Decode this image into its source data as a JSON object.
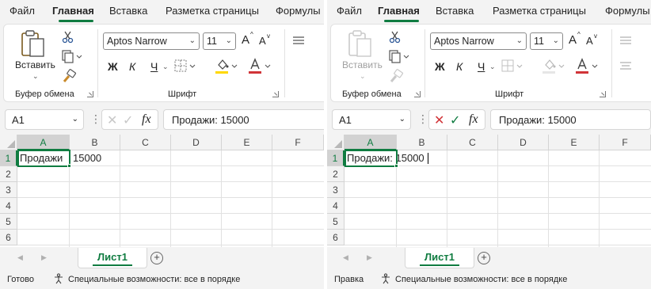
{
  "tabs": [
    "Файл",
    "Главная",
    "Вставка",
    "Разметка страницы",
    "Формулы"
  ],
  "ribbon": {
    "paste_label": "Вставить",
    "clipboard_group": "Буфер обмена",
    "font_group": "Шрифт",
    "font_name": "Aptos Narrow",
    "font_size": "11",
    "bold": "Ж",
    "italic": "К",
    "underline": "Ч",
    "grow_font": "A",
    "shrink_font": "A"
  },
  "formula_bar": {
    "name_box": "A1",
    "fx": "fx",
    "content": "Продажи: 15000"
  },
  "grid": {
    "columns": [
      "A",
      "B",
      "C",
      "D",
      "E",
      "F"
    ],
    "rows": [
      "1",
      "2",
      "3",
      "4",
      "5",
      "6"
    ]
  },
  "left_pane": {
    "cell_a1": "Продажи",
    "cell_b1": "15000",
    "status_mode": "Готово"
  },
  "right_pane": {
    "cell_a1": "Продажи: 15000",
    "status_mode": "Правка"
  },
  "sheet_tab": "Лист1",
  "accessibility": "Специальные возможности: все в порядке",
  "colors": {
    "accent": "#107c41",
    "font_color": "#d13438",
    "highlight": "#ffd800"
  }
}
